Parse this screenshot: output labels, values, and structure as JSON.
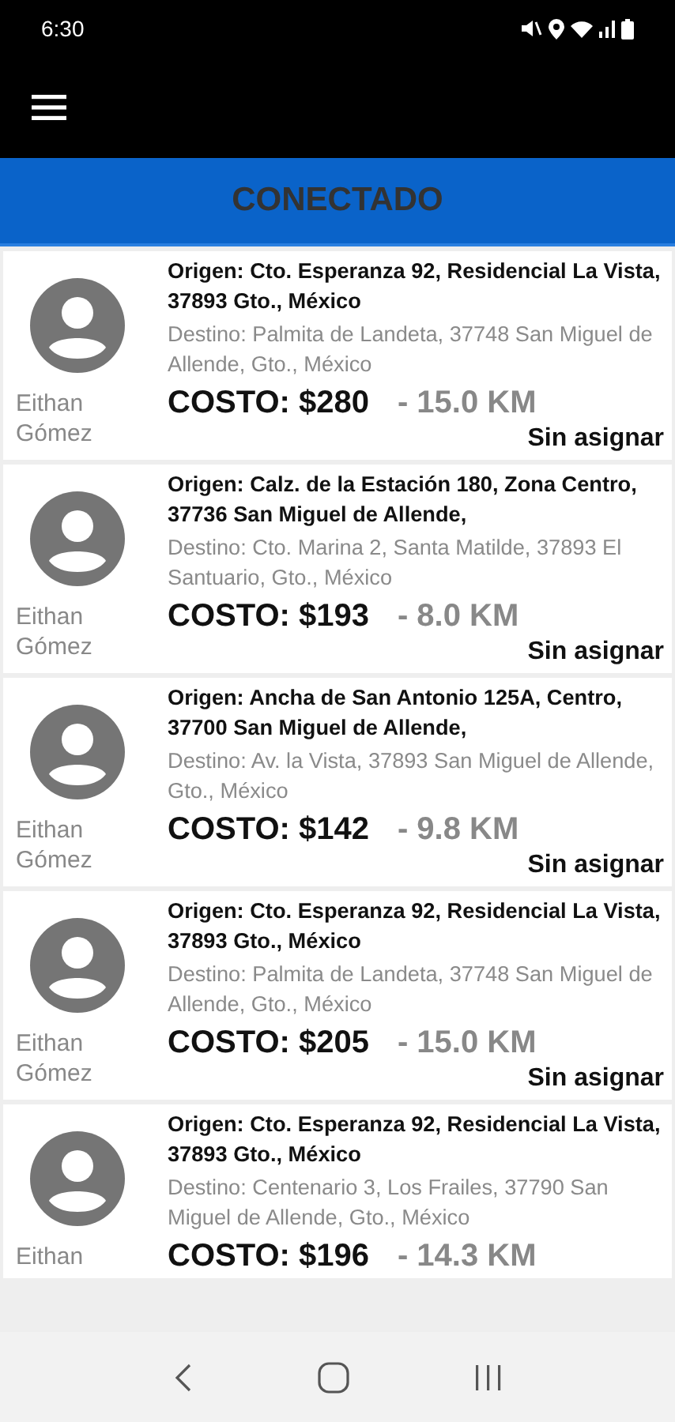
{
  "status_bar": {
    "time": "6:30"
  },
  "banner": {
    "text": "CONECTADO"
  },
  "trips": [
    {
      "name": "Eithan Gómez",
      "origin": "Origen: Cto. Esperanza 92, Residencial La Vista, 37893 Gto., México",
      "destination": "Destino: Palmita de Landeta, 37748 San Miguel de Allende, Gto., México",
      "cost": "COSTO: $280",
      "distance": "- 15.0 KM",
      "status": "Sin asignar"
    },
    {
      "name": "Eithan Gómez",
      "origin": "Origen: Calz. de la Estación 180, Zona Centro, 37736 San Miguel de Allende,",
      "destination": "Destino: Cto. Marina 2, Santa Matilde, 37893 El Santuario, Gto., México",
      "cost": "COSTO: $193",
      "distance": "- 8.0 KM",
      "status": "Sin asignar"
    },
    {
      "name": "Eithan Gómez",
      "origin": "Origen: Ancha de San Antonio 125A, Centro, 37700 San Miguel de Allende,",
      "destination": "Destino: Av. la Vista, 37893 San Miguel de Allende, Gto., México",
      "cost": "COSTO: $142",
      "distance": "- 9.8 KM",
      "status": "Sin asignar"
    },
    {
      "name": "Eithan Gómez",
      "origin": "Origen: Cto. Esperanza 92, Residencial La Vista, 37893 Gto., México",
      "destination": "Destino: Palmita de Landeta, 37748 San Miguel de Allende, Gto., México",
      "cost": "COSTO: $205",
      "distance": "- 15.0 KM",
      "status": "Sin asignar"
    },
    {
      "name": "Eithan",
      "origin": "Origen: Cto. Esperanza 92, Residencial La Vista, 37893 Gto., México",
      "destination": "Destino: Centenario 3, Los Frailes, 37790 San Miguel de Allende, Gto., México",
      "cost": "COSTO: $196",
      "distance": "- 14.3 KM"
    }
  ]
}
